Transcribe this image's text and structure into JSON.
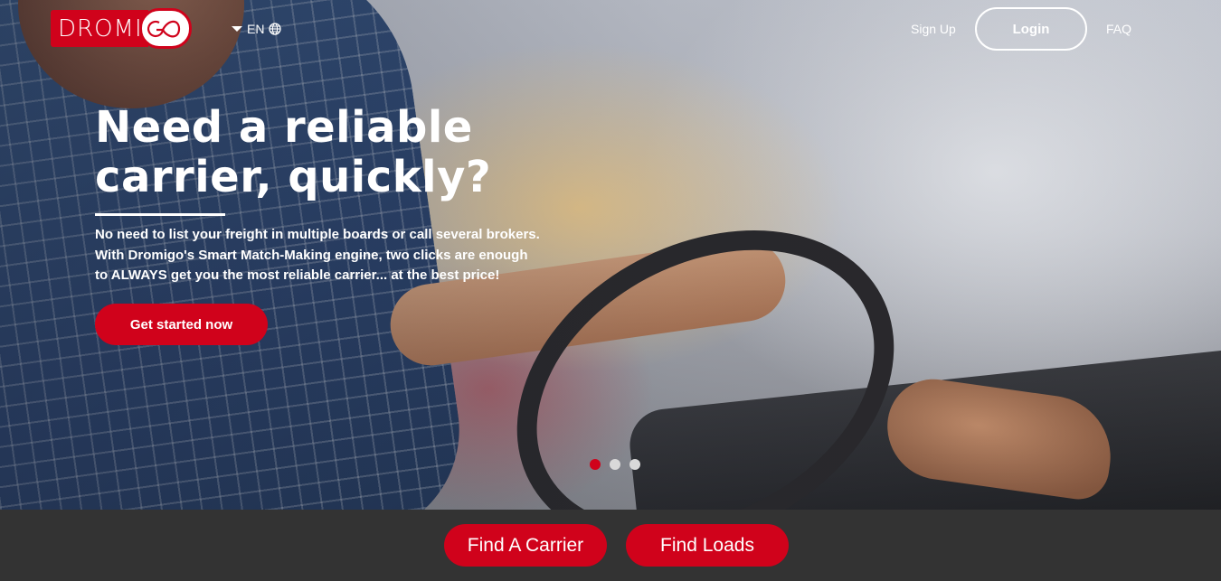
{
  "brand": {
    "logo_text": "DROMI",
    "logo_mark": "GO",
    "accent_color": "#d0021b"
  },
  "language": {
    "label": "EN",
    "caret_icon": "caret-down-icon",
    "globe_icon": "globe-icon"
  },
  "nav": {
    "signup": "Sign Up",
    "login": "Login",
    "faq": "FAQ"
  },
  "hero": {
    "headline_line1": "Need a reliable",
    "headline_line2": "carrier, quickly?",
    "sub_line1": "No need to list your freight in multiple boards or call several brokers.",
    "sub_line2": "With Dromigo's Smart Match-Making engine, two clicks are enough",
    "sub_line3": "to ALWAYS get you the most reliable carrier... at the best price!",
    "cta": "Get started now"
  },
  "carousel": {
    "total": 3,
    "active_index": 0
  },
  "actions": {
    "find_carrier": "Find A Carrier",
    "find_loads": "Find Loads"
  }
}
